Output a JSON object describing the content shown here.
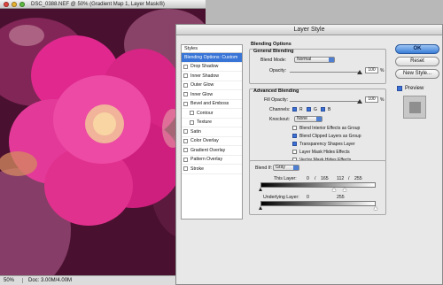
{
  "document": {
    "title": "DSC_0388.NEF @ 50% (Gradient Map 1, Layer Mask/8)",
    "zoom": "50%",
    "doc_size": "Doc: 3.00M/4.00M"
  },
  "dialog": {
    "title": "Layer Style",
    "styles_header": "Styles",
    "styles": [
      {
        "label": "Blending Options: Custom",
        "active": true,
        "checkbox": false
      },
      {
        "label": "Drop Shadow",
        "checkbox": true
      },
      {
        "label": "Inner Shadow",
        "checkbox": true
      },
      {
        "label": "Outer Glow",
        "checkbox": true
      },
      {
        "label": "Inner Glow",
        "checkbox": true
      },
      {
        "label": "Bevel and Emboss",
        "checkbox": true
      },
      {
        "label": "Contour",
        "checkbox": true,
        "indent": true
      },
      {
        "label": "Texture",
        "checkbox": true,
        "indent": true
      },
      {
        "label": "Satin",
        "checkbox": true
      },
      {
        "label": "Color Overlay",
        "checkbox": true
      },
      {
        "label": "Gradient Overlay",
        "checkbox": true
      },
      {
        "label": "Pattern Overlay",
        "checkbox": true
      },
      {
        "label": "Stroke",
        "checkbox": true
      }
    ],
    "blending_options": {
      "title": "Blending Options",
      "general": {
        "title": "General Blending",
        "blend_mode_label": "Blend Mode:",
        "blend_mode_value": "Normal",
        "opacity_label": "Opacity:",
        "opacity_value": "100",
        "opacity_unit": "%"
      },
      "advanced": {
        "title": "Advanced Blending",
        "fill_opacity_label": "Fill Opacity:",
        "fill_opacity_value": "100",
        "fill_opacity_unit": "%",
        "channels_label": "Channels:",
        "channels": [
          "R",
          "G",
          "B"
        ],
        "knockout_label": "Knockout:",
        "knockout_value": "None",
        "checkboxes": [
          {
            "label": "Blend Interior Effects as Group",
            "checked": false
          },
          {
            "label": "Blend Clipped Layers as Group",
            "checked": true
          },
          {
            "label": "Transparency Shapes Layer",
            "checked": true
          },
          {
            "label": "Layer Mask Hides Effects",
            "checked": false
          },
          {
            "label": "Vector Mask Hides Effects",
            "checked": false
          }
        ]
      },
      "blend_if": {
        "label": "Blend If:",
        "value": "Gray",
        "this_layer_label": "This Layer:",
        "this_layer_values": [
          "0",
          "/",
          "165",
          "112",
          "/",
          "255"
        ],
        "underlying_label": "Underlying Layer:",
        "underlying_values": [
          "0",
          "255"
        ]
      }
    },
    "buttons": {
      "ok": "OK",
      "reset": "Reset",
      "new_style": "New Style...",
      "preview": "Preview"
    }
  },
  "colors": {
    "accent": "#3875d7",
    "canvas_magenta": "#c24a8e"
  }
}
